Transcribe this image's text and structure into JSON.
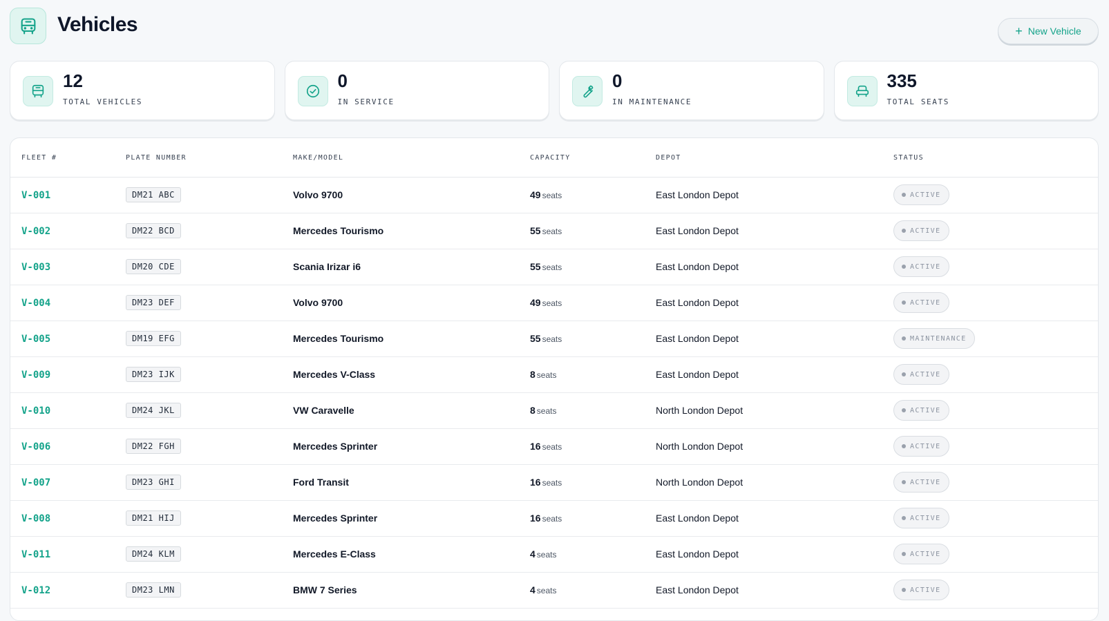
{
  "header": {
    "title": "Vehicles",
    "icon": "bus-icon",
    "new_button_label": "New Vehicle"
  },
  "colors": {
    "accent": "#14a38a",
    "accent_bg": "#e0f5f0",
    "status_text": "#8b93a0"
  },
  "stats": [
    {
      "value": "12",
      "label": "TOTAL VEHICLES",
      "icon": "bus-icon"
    },
    {
      "value": "0",
      "label": "IN SERVICE",
      "icon": "check-circle-icon"
    },
    {
      "value": "0",
      "label": "IN MAINTENANCE",
      "icon": "wrench-icon"
    },
    {
      "value": "335",
      "label": "TOTAL SEATS",
      "icon": "seat-icon"
    }
  ],
  "table": {
    "columns": [
      "FLEET #",
      "PLATE NUMBER",
      "MAKE/MODEL",
      "CAPACITY",
      "DEPOT",
      "STATUS"
    ],
    "capacity_unit": "seats",
    "rows": [
      {
        "fleet": "V-001",
        "plate": "DM21 ABC",
        "make": "Volvo 9700",
        "capacity": "49",
        "depot": "East London Depot",
        "status": "ACTIVE"
      },
      {
        "fleet": "V-002",
        "plate": "DM22 BCD",
        "make": "Mercedes Tourismo",
        "capacity": "55",
        "depot": "East London Depot",
        "status": "ACTIVE"
      },
      {
        "fleet": "V-003",
        "plate": "DM20 CDE",
        "make": "Scania Irizar i6",
        "capacity": "55",
        "depot": "East London Depot",
        "status": "ACTIVE"
      },
      {
        "fleet": "V-004",
        "plate": "DM23 DEF",
        "make": "Volvo 9700",
        "capacity": "49",
        "depot": "East London Depot",
        "status": "ACTIVE"
      },
      {
        "fleet": "V-005",
        "plate": "DM19 EFG",
        "make": "Mercedes Tourismo",
        "capacity": "55",
        "depot": "East London Depot",
        "status": "MAINTENANCE"
      },
      {
        "fleet": "V-009",
        "plate": "DM23 IJK",
        "make": "Mercedes V-Class",
        "capacity": "8",
        "depot": "East London Depot",
        "status": "ACTIVE"
      },
      {
        "fleet": "V-010",
        "plate": "DM24 JKL",
        "make": "VW Caravelle",
        "capacity": "8",
        "depot": "North London Depot",
        "status": "ACTIVE"
      },
      {
        "fleet": "V-006",
        "plate": "DM22 FGH",
        "make": "Mercedes Sprinter",
        "capacity": "16",
        "depot": "North London Depot",
        "status": "ACTIVE"
      },
      {
        "fleet": "V-007",
        "plate": "DM23 GHI",
        "make": "Ford Transit",
        "capacity": "16",
        "depot": "North London Depot",
        "status": "ACTIVE"
      },
      {
        "fleet": "V-008",
        "plate": "DM21 HIJ",
        "make": "Mercedes Sprinter",
        "capacity": "16",
        "depot": "East London Depot",
        "status": "ACTIVE"
      },
      {
        "fleet": "V-011",
        "plate": "DM24 KLM",
        "make": "Mercedes E-Class",
        "capacity": "4",
        "depot": "East London Depot",
        "status": "ACTIVE"
      },
      {
        "fleet": "V-012",
        "plate": "DM23 LMN",
        "make": "BMW 7 Series",
        "capacity": "4",
        "depot": "East London Depot",
        "status": "ACTIVE"
      }
    ]
  }
}
